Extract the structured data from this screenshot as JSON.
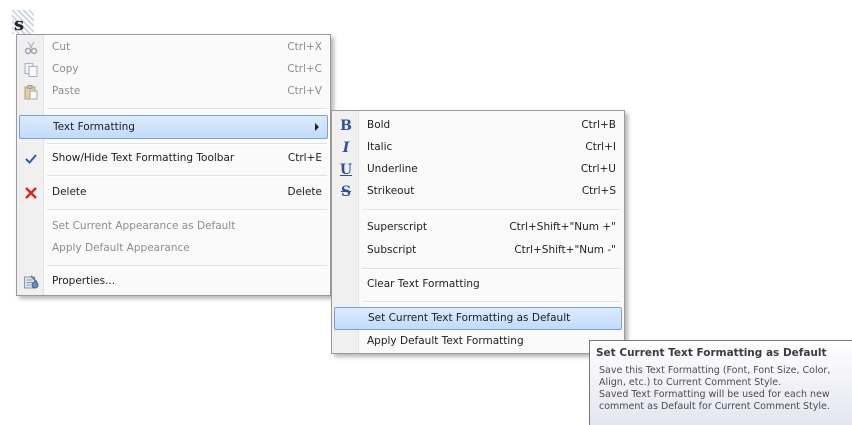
{
  "document": {
    "caret_char": "s"
  },
  "context_menu": {
    "items": [
      {
        "label": "Cut",
        "shortcut": "Ctrl+X",
        "icon": "scissors-icon",
        "enabled": false
      },
      {
        "label": "Copy",
        "shortcut": "Ctrl+C",
        "icon": "copy-icon",
        "enabled": false
      },
      {
        "label": "Paste",
        "shortcut": "Ctrl+V",
        "icon": "paste-icon",
        "enabled": false
      },
      {
        "label": "Text Formatting",
        "shortcut": "",
        "icon": "",
        "enabled": true,
        "has_submenu": true,
        "highlighted": true
      },
      {
        "label": "Show/Hide Text Formatting Toolbar",
        "shortcut": "Ctrl+E",
        "icon": "checkmark-icon",
        "enabled": true,
        "checked": true
      },
      {
        "label": "Delete",
        "shortcut": "Delete",
        "icon": "red-x-icon",
        "enabled": true
      },
      {
        "label": "Set Current Appearance as Default",
        "shortcut": "",
        "icon": "",
        "enabled": false
      },
      {
        "label": "Apply Default Appearance",
        "shortcut": "",
        "icon": "",
        "enabled": false
      },
      {
        "label": "Properties...",
        "shortcut": "",
        "icon": "properties-icon",
        "enabled": true
      }
    ]
  },
  "submenu": {
    "items": [
      {
        "label": "Bold",
        "shortcut": "Ctrl+B",
        "icon_glyph": "B",
        "icon": "bold-icon"
      },
      {
        "label": "Italic",
        "shortcut": "Ctrl+I",
        "icon_glyph": "I",
        "icon": "italic-icon"
      },
      {
        "label": "Underline",
        "shortcut": "Ctrl+U",
        "icon_glyph": "U",
        "icon": "underline-icon"
      },
      {
        "label": "Strikeout",
        "shortcut": "Ctrl+S",
        "icon_glyph": "S",
        "icon": "strikeout-icon"
      },
      {
        "label": "Superscript",
        "shortcut": "Ctrl+Shift+\"Num +\"",
        "icon_glyph": "",
        "icon": ""
      },
      {
        "label": "Subscript",
        "shortcut": "Ctrl+Shift+\"Num -\"",
        "icon_glyph": "",
        "icon": ""
      },
      {
        "label": "Clear Text Formatting",
        "shortcut": "",
        "icon_glyph": "",
        "icon": ""
      },
      {
        "label": "Set Current Text Formatting as Default",
        "shortcut": "",
        "icon_glyph": "",
        "icon": "",
        "highlighted": true
      },
      {
        "label": "Apply Default Text Formatting",
        "shortcut": "",
        "icon_glyph": "",
        "icon": ""
      }
    ]
  },
  "tooltip": {
    "title": "Set Current Text Formatting as Default",
    "body": "Save this Text Formatting (Font, Font Size, Color,\nAlign, etc.) to Current Comment Style.\nSaved Text Formatting will be used for each new\ncomment as Default for Current Comment Style."
  },
  "colors": {
    "highlight_border": "#7da2ce",
    "highlight_fill": "#c1dbfc",
    "disabled_text": "#8d8d8d",
    "format_icon": "#2f4f99",
    "delete_icon": "#d9261c",
    "check_icon": "#2a5fb0"
  }
}
